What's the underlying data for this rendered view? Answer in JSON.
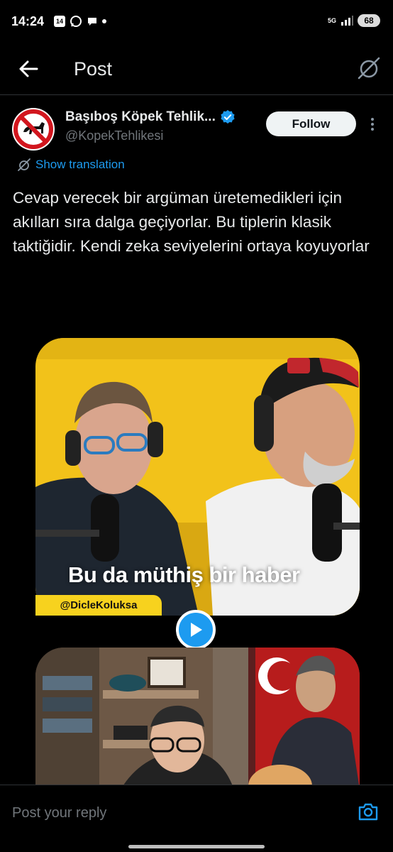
{
  "status_bar": {
    "time": "14:24",
    "calendar_day": "14",
    "network": "5G",
    "battery": "68"
  },
  "header": {
    "title": "Post",
    "back_icon": "arrow-left-icon",
    "grok_icon": "grok-icon"
  },
  "post": {
    "author_name": "Başıboş Köpek Tehlik...",
    "author_handle": "@KopekTehlikesi",
    "verified": true,
    "follow_label": "Follow",
    "translate_label": "Show translation",
    "text": "Cevap verecek bir argüman üretemedikleri için akılları sıra dalga geçiyorlar. Bu tiplerin klasik taktiğidir. Kendi zeka seviyelerini ortaya koyuyorlar"
  },
  "media": {
    "caption": "Bu da müthiş bir haber",
    "watermark": "@DicleKoluksa",
    "play_icon": "play-icon"
  },
  "reply": {
    "placeholder": "Post your reply",
    "camera_icon": "camera-icon"
  },
  "colors": {
    "accent": "#1d9bf0",
    "background": "#000000",
    "text": "#e7e9ea",
    "muted": "#71767b"
  }
}
